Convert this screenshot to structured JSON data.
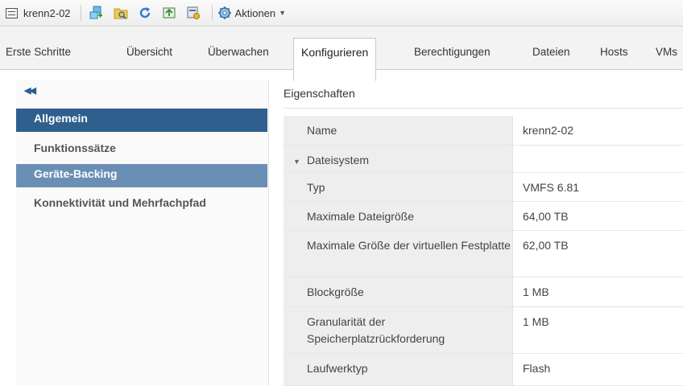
{
  "toolbar": {
    "title": "krenn2-02",
    "actions_label": "Aktionen"
  },
  "tabs": [
    {
      "label": "Erste Schritte"
    },
    {
      "label": "Übersicht"
    },
    {
      "label": "Überwachen"
    },
    {
      "label": "Konfigurieren",
      "active": true
    },
    {
      "label": "Berechtigungen"
    },
    {
      "label": "Dateien"
    },
    {
      "label": "Hosts"
    },
    {
      "label": "VMs"
    }
  ],
  "sidebar": {
    "collapse_icon": "double-chevron-left-icon",
    "items": [
      {
        "label": "Allgemein",
        "selected": true
      },
      {
        "label": "Funktionssätze"
      },
      {
        "label": "Geräte-Backing",
        "highlighted": true
      },
      {
        "label": "Konnektivität und Mehrfachpfad"
      }
    ]
  },
  "properties": {
    "header": "Eigenschaften",
    "rows": [
      {
        "name": "Name",
        "value": "krenn2-02"
      },
      {
        "name": "Dateisystem",
        "value": "",
        "group": true
      },
      {
        "name": "Typ",
        "value": "VMFS 6.81"
      },
      {
        "name": "Maximale Dateigröße",
        "value": "64,00 TB"
      },
      {
        "name": "Maximale Größe der virtuellen Festplatte",
        "value": "62,00 TB"
      },
      {
        "name": "Blockgröße",
        "value": "1 MB"
      },
      {
        "name": "Granularität der Speicherplatzrückforderung",
        "value": "1 MB"
      },
      {
        "name": "Laufwerktyp",
        "value": "Flash"
      }
    ]
  },
  "colors": {
    "sidebar_selected": "#2f5f8d",
    "sidebar_highlight": "#6a8fb4",
    "accent": "#2a5d8f"
  }
}
